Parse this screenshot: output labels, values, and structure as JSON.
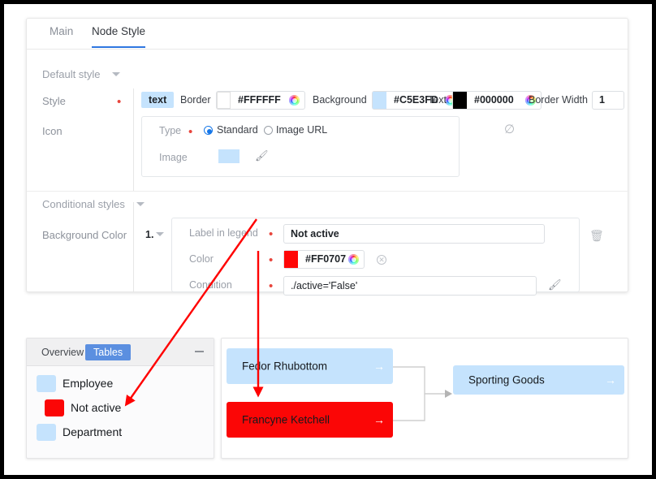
{
  "window": {
    "border_color": "#000000"
  },
  "settings": {
    "tabs": [
      {
        "label": "Main",
        "active": false
      },
      {
        "label": "Node Style",
        "active": true
      }
    ],
    "groups": {
      "default_style": "Default style",
      "conditional_styles": "Conditional styles"
    },
    "style_row": {
      "label": "Style",
      "badge": "text",
      "border_label": "Border",
      "border_value": "#FFFFFF",
      "border_swatch": "#FFFFFF",
      "background_label": "Background",
      "background_value": "#C5E3FD",
      "background_swatch": "#C5E3FD",
      "text_label": "Text",
      "text_value": "#000000",
      "text_swatch": "#000000",
      "border_width_label": "Border Width",
      "border_width_value": "1"
    },
    "icon_row": {
      "label": "Icon",
      "type_label": "Type",
      "options": [
        {
          "label": "Standard",
          "selected": true
        },
        {
          "label": "Image URL",
          "selected": false
        }
      ],
      "image_label": "Image",
      "image_swatch": "#C5E3FD",
      "wand_icon": "magic-wand-icon",
      "null_icon": "null-slash-icon"
    },
    "background_color_row": {
      "label": "Background Color",
      "index": "1.",
      "label_in_legend_label": "Label in legend",
      "label_in_legend_value": "Not active",
      "color_label": "Color",
      "color_value": "#FF0707",
      "color_swatch": "#FF0707",
      "condition_label": "Condition",
      "condition_value": "./active='False'",
      "delete_icon": "trash-icon",
      "clear_icon": "clear-circle-icon",
      "wand_icon": "magic-wand-icon"
    }
  },
  "legend_panel": {
    "tabs": [
      {
        "label": "Overview",
        "active": false
      },
      {
        "label": "Tables",
        "active": true
      }
    ],
    "minimize_icon": "minimize-icon",
    "items": [
      {
        "label": "Employee",
        "color": "#C5E3FD",
        "indent": 0
      },
      {
        "label": "Not active",
        "color": "#FB0606",
        "indent": 1
      },
      {
        "label": "Department",
        "color": "#C5E3FD",
        "indent": 0
      }
    ]
  },
  "diagram": {
    "nodes": [
      {
        "label": "Fedor Rhubottom",
        "fill": "#C5E3FD",
        "arrow_color": "#ffffff"
      },
      {
        "label": "Francyne Ketchell",
        "fill": "#FB0606",
        "arrow_color": "#ffffff"
      },
      {
        "label": "Sporting Goods",
        "fill": "#C5E3FD",
        "arrow_color": "#ffffff"
      }
    ],
    "connector_arrow": "→"
  },
  "annotations": {
    "arrow_color": "#FF0000",
    "arrows": [
      {
        "name": "legend-label-annotation",
        "from": "label-in-legend-field",
        "to": "legend-item-not-active"
      },
      {
        "name": "color-annotation",
        "from": "color-field",
        "to": "node-francyne-ketchell"
      }
    ]
  }
}
